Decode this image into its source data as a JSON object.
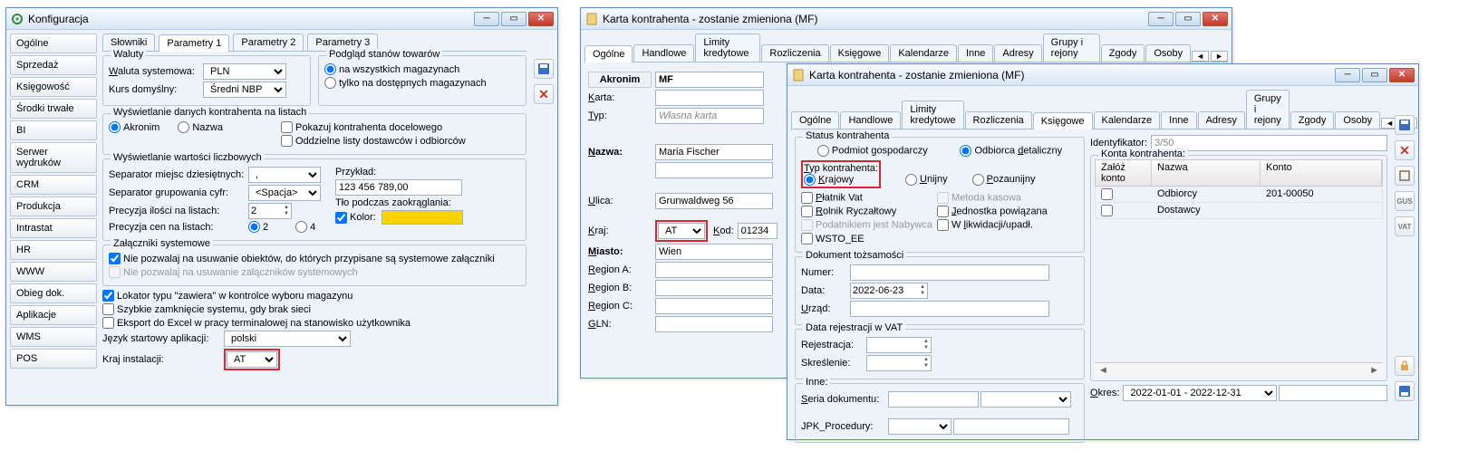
{
  "window1": {
    "title": "Konfiguracja",
    "nav": [
      "Ogólne",
      "Sprzedaż",
      "Księgowość",
      "Środki trwałe",
      "BI",
      "Serwer wydruków",
      "CRM",
      "Produkcja",
      "Intrastat",
      "HR",
      "WWW",
      "Obieg dok.",
      "Aplikacje",
      "WMS",
      "POS"
    ],
    "topTabs": [
      "Słowniki",
      "Parametry 1",
      "Parametry 2",
      "Parametry 3"
    ],
    "waluty": {
      "legend": "Waluty",
      "systemowa_label": "Waluta systemowa:",
      "systemowa_value": "PLN",
      "kurs_label": "Kurs domyślny:",
      "kurs_value": "Średni NBP"
    },
    "podglad": {
      "legend": "Podgląd stanów towarów",
      "opt1": "na wszystkich magazynach",
      "opt2": "tylko na dostępnych magazynach"
    },
    "wyswietlanie_kontrahenta": {
      "legend": "Wyświetlanie danych kontrahenta na listach",
      "akronim": "Akronim",
      "nazwa": "Nazwa",
      "pokazuj": "Pokazuj kontrahenta docelowego",
      "oddzielne": "Oddzielne listy dostawców i odbiorców"
    },
    "liczbowe": {
      "legend": "Wyświetlanie wartości liczbowych",
      "sep_miejsc": "Separator miejsc dziesiętnych:",
      "sep_miejsc_value": ",",
      "sep_grup": "Separator grupowania cyfr:",
      "sep_grup_value": "<Spacja>",
      "prec_ilosci": "Precyzja ilości na listach:",
      "prec_ilosci_value": "2",
      "prec_cen": "Precyzja cen na listach:",
      "r2": "2",
      "r4": "4",
      "przyklad": "Przykład:",
      "przyklad_value": "123 456 789,00",
      "tlo": "Tło podczas zaokrąglania:",
      "kolor": "Kolor:"
    },
    "zalaczniki": {
      "legend": "Załączniki systemowe",
      "c1": "Nie pozwalaj na usuwanie obiektów, do których przypisane są systemowe załączniki",
      "c2": "Nie pozwalaj na usuwanie załączników systemowych"
    },
    "lokator": "Lokator typu \"zawiera\" w kontrolce wyboru magazynu",
    "szybkie": "Szybkie zamknięcie systemu, gdy brak sieci",
    "eksport": "Eksport do Excel w pracy terminalowej na stanowisko użytkownika",
    "jezyk_label": "Język startowy aplikacji:",
    "jezyk_value": "polski",
    "kraj_label": "Kraj instalacji:",
    "kraj_value": "AT"
  },
  "window2": {
    "title": "Karta kontrahenta - zostanie zmieniona (MF)",
    "tabs": [
      "Ogólne",
      "Handlowe",
      "Limity kredytowe",
      "Rozliczenia",
      "Księgowe",
      "Kalendarze",
      "Inne",
      "Adresy",
      "Grupy i rejony",
      "Zgody",
      "Osoby"
    ],
    "akronim_label": "Akronim",
    "akronim_value": "MF",
    "karta_label": "Karta:",
    "typ_label": "Typ:",
    "typ_value": "Własna karta",
    "nazwa_label": "Nazwa:",
    "nazwa_value": "Maria Fischer",
    "ulica_label": "Ulica:",
    "ulica_value": "Grunwaldweg 56",
    "kraj_label": "Kraj:",
    "kraj_value": "AT",
    "kod_label": "Kod:",
    "kod_value": "01234",
    "miasto_label": "Miasto:",
    "miasto_value": "Wien",
    "regionA_label": "Region A:",
    "regionB_label": "Region B:",
    "regionC_label": "Region C:",
    "gln_label": "GLN:"
  },
  "window3": {
    "title": "Karta kontrahenta - zostanie zmieniona (MF)",
    "tabs": [
      "Ogólne",
      "Handlowe",
      "Limity kredytowe",
      "Rozliczenia",
      "Księgowe",
      "Kalendarze",
      "Inne",
      "Adresy",
      "Grupy i rejony",
      "Zgody",
      "Osoby"
    ],
    "status": {
      "legend": "Status kontrahenta",
      "podmiot": "Podmiot gospodarczy",
      "odbiorca": "Odbiorca detaliczny",
      "typ_legend": "Typ kontrahenta:",
      "krajowy": "Krajowy",
      "unijny": "Unijny",
      "pozaunijny": "Pozaunijny",
      "platnik": "Płatnik Vat",
      "metoda": "Metoda kasowa",
      "rolnik": "Rolnik Ryczałtowy",
      "jednostka": "Jednostka powiązana",
      "podatnik": "Podatnikiem jest Nabywca",
      "likwidacja": "W likwidacji/upadł.",
      "wsto": "WSTO_EE"
    },
    "dokument": {
      "legend": "Dokument tożsamości",
      "numer": "Numer:",
      "data_label": "Data:",
      "data_value": "2022-06-23",
      "urzad": "Urząd:"
    },
    "vat": {
      "legend": "Data rejestracji w VAT",
      "rejestracja": "Rejestracja:",
      "skreslenie": "Skreślenie:"
    },
    "inne": {
      "legend": "Inne:",
      "seria": "Seria dokumentu:",
      "jpk": "JPK_Procedury:"
    },
    "identyfikator_label": "Identyfikator:",
    "identyfikator_value": "3/50",
    "konta_legend": "Konta kontrahenta:",
    "zaloz_konto": "Załóż konto",
    "col_nazwa": "Nazwa",
    "col_konto": "Konto",
    "rows": [
      {
        "nazwa": "Odbiorcy",
        "konto": "201-00050"
      },
      {
        "nazwa": "Dostawcy",
        "konto": ""
      }
    ],
    "okres_label": "Okres:",
    "okres_value": "2022-01-01 - 2022-12-31"
  }
}
